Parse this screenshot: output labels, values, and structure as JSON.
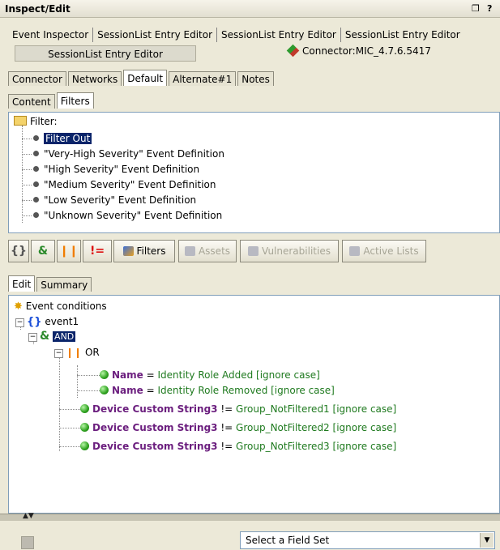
{
  "window": {
    "title": "Inspect/Edit",
    "controls": [
      "restore",
      "?"
    ]
  },
  "editor_tabs": [
    "Event Inspector",
    "SessionList Entry Editor",
    "SessionList Entry Editor",
    "SessionList Entry Editor"
  ],
  "active_editor": "SessionList Entry Editor",
  "connector_label": "Connector:MIC_4.7.6.5417",
  "resource_tabs": [
    {
      "label": "Connector",
      "active": false
    },
    {
      "label": "Networks",
      "active": false
    },
    {
      "label": "Default",
      "active": true
    },
    {
      "label": "Alternate#1",
      "active": false
    },
    {
      "label": "Notes",
      "active": false
    }
  ],
  "sub_tabs": [
    {
      "label": "Content",
      "active": false
    },
    {
      "label": "Filters",
      "active": true
    }
  ],
  "filter_tree": {
    "root": "Filter:",
    "items": [
      "Filter Out",
      "\"Very-High Severity\" Event Definition",
      "\"High Severity\" Event Definition",
      "\"Medium Severity\" Event Definition",
      "\"Low Severity\" Event Definition",
      "\"Unknown Severity\" Event Definition"
    ],
    "selected_index": 0
  },
  "toolbar": {
    "filters_label": "Filters",
    "assets_label": "Assets",
    "vulnerabilities_label": "Vulnerabilities",
    "active_lists_label": "Active Lists"
  },
  "edit_tabs": [
    {
      "label": "Edit",
      "active": true
    },
    {
      "label": "Summary",
      "active": false
    }
  ],
  "conditions": {
    "root": "Event conditions",
    "event": "event1",
    "and": "AND",
    "or": "OR",
    "or_rows": [
      {
        "field": "Name",
        "op": "=",
        "value": "Identity Role Added [ignore case]"
      },
      {
        "field": "Name",
        "op": "=",
        "value": "Identity Role Removed [ignore case]"
      }
    ],
    "and_rows": [
      {
        "field": "Device Custom String3",
        "op": "!=",
        "value": "Group_NotFiltered1 [ignore case]"
      },
      {
        "field": "Device Custom String3",
        "op": "!=",
        "value": "Group_NotFiltered2 [ignore case]"
      },
      {
        "field": "Device Custom String3",
        "op": "!=",
        "value": "Group_NotFiltered3 [ignore case]"
      }
    ]
  },
  "field_set": {
    "selected": "Select a Field Set"
  }
}
